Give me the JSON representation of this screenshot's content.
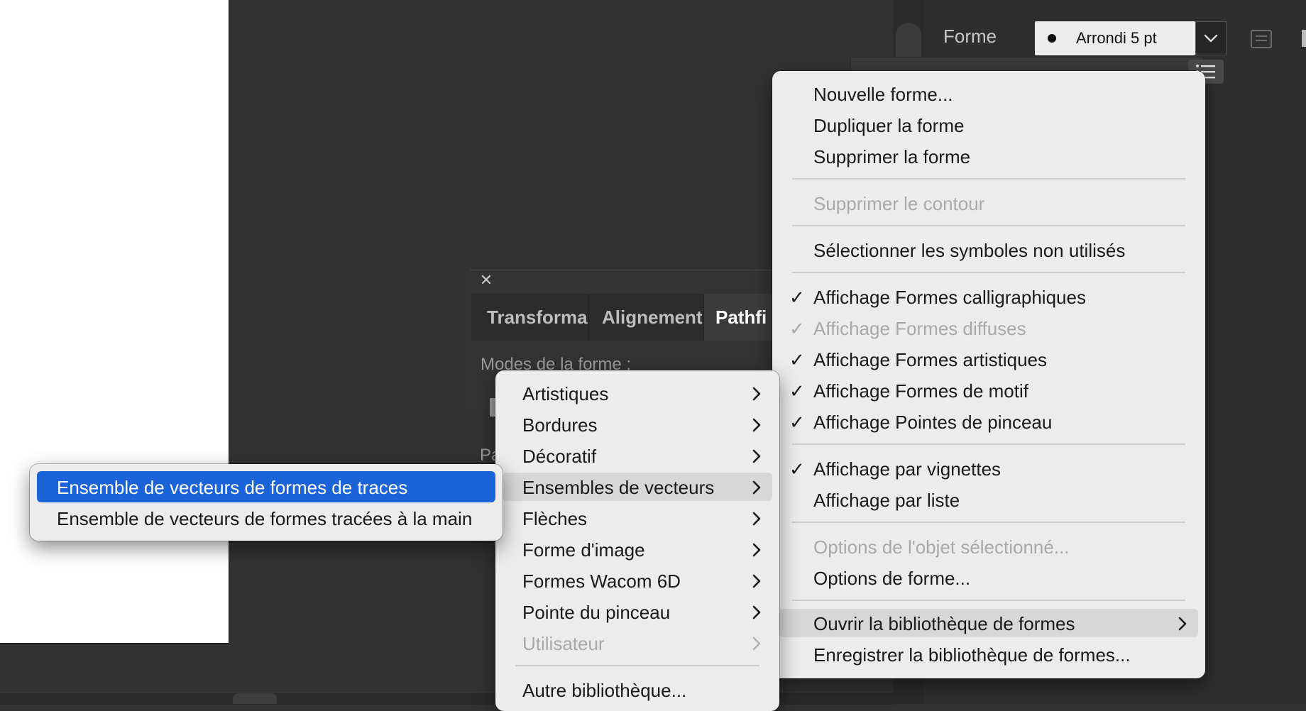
{
  "dock": {
    "label": "Forme",
    "brush_value": "Arrondi 5 pt"
  },
  "pathfinder": {
    "tabs": [
      "Transforma",
      "Alignement",
      "Pathfi"
    ],
    "modes_label": "Modes de la forme :",
    "partial_label": "Pa"
  },
  "main_menu": {
    "items": [
      {
        "label": "Nouvelle forme...",
        "checked": false,
        "disabled": false
      },
      {
        "label": "Dupliquer la forme",
        "checked": false,
        "disabled": false
      },
      {
        "label": "Supprimer la forme",
        "checked": false,
        "disabled": false
      },
      {
        "label": "Supprimer le contour",
        "checked": false,
        "disabled": true
      },
      {
        "label": "Sélectionner les symboles non utilisés",
        "checked": false,
        "disabled": false
      },
      {
        "label": "Affichage Formes calligraphiques",
        "checked": true,
        "disabled": false
      },
      {
        "label": "Affichage Formes diffuses",
        "checked": true,
        "disabled": true
      },
      {
        "label": "Affichage Formes artistiques",
        "checked": true,
        "disabled": false
      },
      {
        "label": "Affichage Formes de motif",
        "checked": true,
        "disabled": false
      },
      {
        "label": "Affichage Pointes de pinceau",
        "checked": true,
        "disabled": false
      },
      {
        "label": "Affichage par vignettes",
        "checked": true,
        "disabled": false
      },
      {
        "label": "Affichage par liste",
        "checked": false,
        "disabled": false
      },
      {
        "label": "Options de l'objet sélectionné...",
        "checked": false,
        "disabled": true
      },
      {
        "label": "Options de forme...",
        "checked": false,
        "disabled": false
      },
      {
        "label": "Ouvrir la bibliothèque de formes",
        "checked": false,
        "disabled": false,
        "submenu": true,
        "highlighted": true
      },
      {
        "label": "Enregistrer la bibliothèque de formes...",
        "checked": false,
        "disabled": false
      }
    ],
    "check_glyph": "✓"
  },
  "library_menu": {
    "items": [
      {
        "label": "Artistiques",
        "disabled": false
      },
      {
        "label": "Bordures",
        "disabled": false
      },
      {
        "label": "Décoratif",
        "disabled": false
      },
      {
        "label": "Ensembles de vecteurs",
        "disabled": false,
        "highlighted": true
      },
      {
        "label": "Flèches",
        "disabled": false
      },
      {
        "label": "Forme d'image",
        "disabled": false
      },
      {
        "label": "Formes Wacom 6D",
        "disabled": false
      },
      {
        "label": "Pointe du pinceau",
        "disabled": false
      },
      {
        "label": "Utilisateur",
        "disabled": true
      }
    ],
    "other_label": "Autre bibliothèque..."
  },
  "vector_menu": {
    "items": [
      {
        "label": "Ensemble de vecteurs de formes de traces",
        "selected": true
      },
      {
        "label": "Ensemble de vecteurs de formes tracées à la main",
        "selected": false
      }
    ]
  },
  "colors": {
    "selection": "#1a63d8",
    "menu_bg": "#ececec",
    "workspace": "#323232"
  }
}
